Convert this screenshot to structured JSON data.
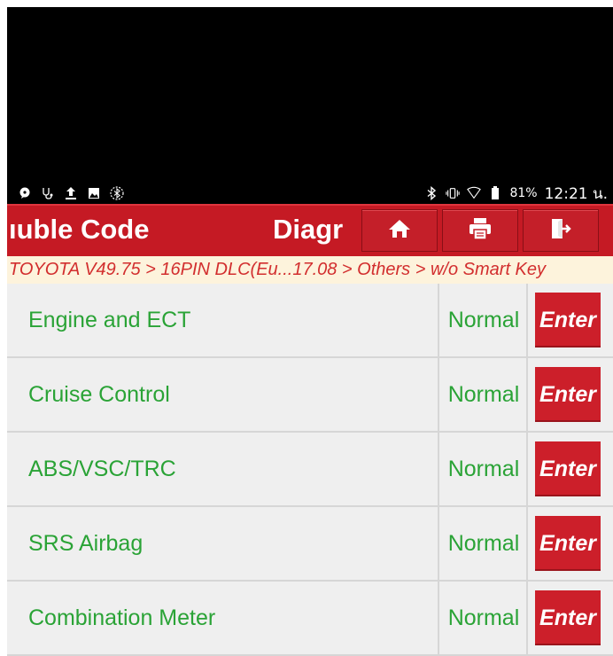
{
  "status_bar": {
    "battery": "81%",
    "time": "12:21 น.",
    "icons_left": [
      "chat-bubble-icon",
      "stethoscope-icon",
      "upload-icon",
      "image-icon",
      "bluetooth-circle-icon"
    ],
    "icons_right": [
      "bluetooth-icon",
      "vibrate-icon",
      "wifi-icon",
      "battery-icon"
    ]
  },
  "header": {
    "title_left": "ıuble Code",
    "title_center": "Diagr",
    "buttons": [
      "home-icon",
      "printer-icon",
      "exit-icon"
    ],
    "accent_color": "#c51a24"
  },
  "breadcrumb": {
    "text": "TOYOTA V49.75 > 16PIN DLC(Eu...17.08 > Others > w/o Smart Key"
  },
  "systems": [
    {
      "name": "Engine and ECT",
      "status": "Normal",
      "action": "Enter"
    },
    {
      "name": "Cruise Control",
      "status": "Normal",
      "action": "Enter"
    },
    {
      "name": "ABS/VSC/TRC",
      "status": "Normal",
      "action": "Enter"
    },
    {
      "name": "SRS Airbag",
      "status": "Normal",
      "action": "Enter"
    },
    {
      "name": "Combination Meter",
      "status": "Normal",
      "action": "Enter"
    }
  ],
  "colors": {
    "text_green": "#2aa336",
    "button_red": "#cc1f2a",
    "breadcrumb_bg": "#fdf3dc",
    "breadcrumb_text": "#d22e2e"
  }
}
